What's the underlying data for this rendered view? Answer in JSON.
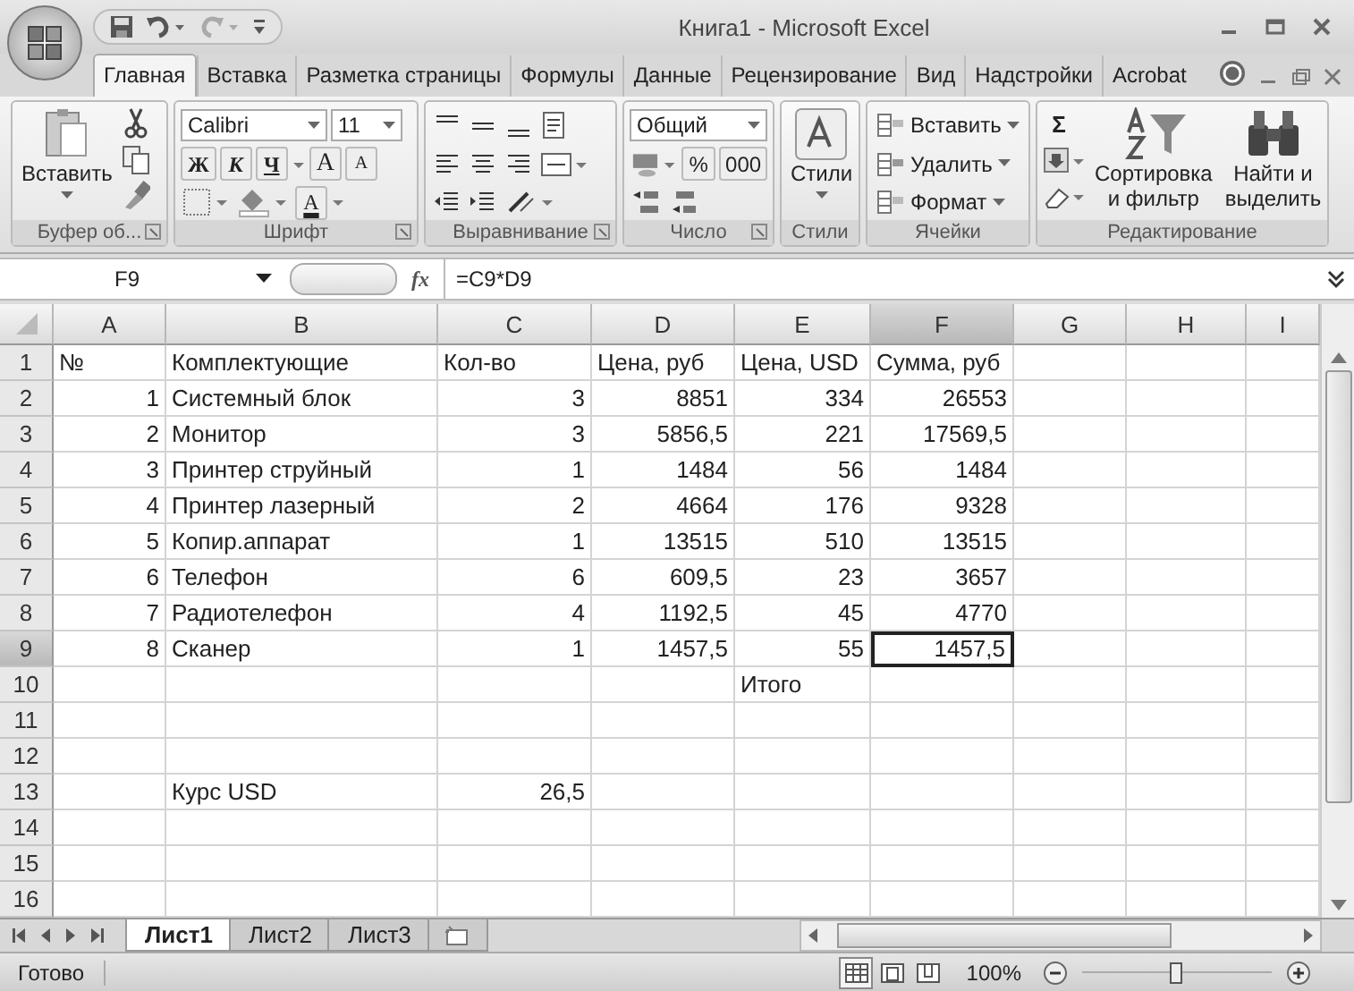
{
  "window": {
    "title": "Книга1 - Microsoft Excel"
  },
  "tabs": [
    {
      "label": "Главная",
      "selected": true
    },
    {
      "label": "Вставка",
      "selected": false
    },
    {
      "label": "Разметка страницы",
      "selected": false
    },
    {
      "label": "Формулы",
      "selected": false
    },
    {
      "label": "Данные",
      "selected": false
    },
    {
      "label": "Рецензирование",
      "selected": false
    },
    {
      "label": "Вид",
      "selected": false
    },
    {
      "label": "Надстройки",
      "selected": false
    },
    {
      "label": "Acrobat",
      "selected": false
    }
  ],
  "ribbon": {
    "clipboard": {
      "label": "Буфер об...",
      "paste": "Вставить"
    },
    "font": {
      "label": "Шрифт",
      "font": "Calibri",
      "size": "11",
      "bold": "Ж",
      "italic": "К",
      "underline": "Ч",
      "grow": "A",
      "shrink": "A",
      "color_letter": "A"
    },
    "alignment": {
      "label": "Выравнивание"
    },
    "number": {
      "label": "Число",
      "format": "Общий",
      "percent": "%",
      "thousands": "000"
    },
    "styles": {
      "label": "Стили",
      "button": "Стили"
    },
    "cells": {
      "label": "Ячейки",
      "buttons": [
        "Вставить",
        "Удалить",
        "Формат"
      ]
    },
    "editing": {
      "label": "Редактирование",
      "sigma": "Σ",
      "sort": [
        "Сортировка",
        "и фильтр"
      ],
      "find": [
        "Найти и",
        "выделить"
      ]
    }
  },
  "formula_bar": {
    "name_box": "F9",
    "fx": "fx",
    "formula": "=C9*D9"
  },
  "columns": [
    {
      "label": "A",
      "selected": false
    },
    {
      "label": "B",
      "selected": false
    },
    {
      "label": "C",
      "selected": false
    },
    {
      "label": "D",
      "selected": false
    },
    {
      "label": "E",
      "selected": false
    },
    {
      "label": "F",
      "selected": true
    },
    {
      "label": "G",
      "selected": false
    },
    {
      "label": "H",
      "selected": false
    },
    {
      "label": "I",
      "selected": false
    }
  ],
  "rows": [
    {
      "number": "1",
      "selected": false,
      "cells": [
        {
          "text": "№",
          "kind": "text"
        },
        {
          "text": "Комплектующие",
          "kind": "text"
        },
        {
          "text": "Кол-во",
          "kind": "text"
        },
        {
          "text": "Цена, руб",
          "kind": "text"
        },
        {
          "text": "Цена, USD",
          "kind": "text"
        },
        {
          "text": "Сумма, руб",
          "kind": "text"
        },
        {},
        {},
        {}
      ]
    },
    {
      "number": "2",
      "selected": false,
      "cells": [
        {
          "text": "1",
          "kind": "number"
        },
        {
          "text": "Системный блок",
          "kind": "text"
        },
        {
          "text": "3",
          "kind": "number"
        },
        {
          "text": "8851",
          "kind": "number"
        },
        {
          "text": "334",
          "kind": "number"
        },
        {
          "text": "26553",
          "kind": "number"
        },
        {},
        {},
        {}
      ]
    },
    {
      "number": "3",
      "selected": false,
      "cells": [
        {
          "text": "2",
          "kind": "number"
        },
        {
          "text": "Монитор",
          "kind": "text"
        },
        {
          "text": "3",
          "kind": "number"
        },
        {
          "text": "5856,5",
          "kind": "number"
        },
        {
          "text": "221",
          "kind": "number"
        },
        {
          "text": "17569,5",
          "kind": "number"
        },
        {},
        {},
        {}
      ]
    },
    {
      "number": "4",
      "selected": false,
      "cells": [
        {
          "text": "3",
          "kind": "number"
        },
        {
          "text": "Принтер струйный",
          "kind": "text"
        },
        {
          "text": "1",
          "kind": "number"
        },
        {
          "text": "1484",
          "kind": "number"
        },
        {
          "text": "56",
          "kind": "number"
        },
        {
          "text": "1484",
          "kind": "number"
        },
        {},
        {},
        {}
      ]
    },
    {
      "number": "5",
      "selected": false,
      "cells": [
        {
          "text": "4",
          "kind": "number"
        },
        {
          "text": "Принтер лазерный",
          "kind": "text"
        },
        {
          "text": "2",
          "kind": "number"
        },
        {
          "text": "4664",
          "kind": "number"
        },
        {
          "text": "176",
          "kind": "number"
        },
        {
          "text": "9328",
          "kind": "number"
        },
        {},
        {},
        {}
      ]
    },
    {
      "number": "6",
      "selected": false,
      "cells": [
        {
          "text": "5",
          "kind": "number"
        },
        {
          "text": "Копир.аппарат",
          "kind": "text"
        },
        {
          "text": "1",
          "kind": "number"
        },
        {
          "text": "13515",
          "kind": "number"
        },
        {
          "text": "510",
          "kind": "number"
        },
        {
          "text": "13515",
          "kind": "number"
        },
        {},
        {},
        {}
      ]
    },
    {
      "number": "7",
      "selected": false,
      "cells": [
        {
          "text": "6",
          "kind": "number"
        },
        {
          "text": "Телефон",
          "kind": "text"
        },
        {
          "text": "6",
          "kind": "number"
        },
        {
          "text": "609,5",
          "kind": "number"
        },
        {
          "text": "23",
          "kind": "number"
        },
        {
          "text": "3657",
          "kind": "number"
        },
        {},
        {},
        {}
      ]
    },
    {
      "number": "8",
      "selected": false,
      "cells": [
        {
          "text": "7",
          "kind": "number"
        },
        {
          "text": "Радиотелефон",
          "kind": "text"
        },
        {
          "text": "4",
          "kind": "number"
        },
        {
          "text": "1192,5",
          "kind": "number"
        },
        {
          "text": "45",
          "kind": "number"
        },
        {
          "text": "4770",
          "kind": "number"
        },
        {},
        {},
        {}
      ]
    },
    {
      "number": "9",
      "selected": true,
      "cells": [
        {
          "text": "8",
          "kind": "number"
        },
        {
          "text": "Сканер",
          "kind": "text"
        },
        {
          "text": "1",
          "kind": "number"
        },
        {
          "text": "1457,5",
          "kind": "number"
        },
        {
          "text": "55",
          "kind": "number"
        },
        {
          "text": "1457,5",
          "kind": "number"
        },
        {},
        {},
        {}
      ]
    },
    {
      "number": "10",
      "selected": false,
      "cells": [
        {},
        {},
        {},
        {},
        {
          "text": "Итого",
          "kind": "text"
        },
        {},
        {},
        {},
        {}
      ]
    },
    {
      "number": "11",
      "selected": false,
      "cells": [
        {},
        {},
        {},
        {},
        {},
        {},
        {},
        {},
        {}
      ]
    },
    {
      "number": "12",
      "selected": false,
      "cells": [
        {},
        {},
        {},
        {},
        {},
        {},
        {},
        {},
        {}
      ]
    },
    {
      "number": "13",
      "selected": false,
      "cells": [
        {},
        {
          "text": "Курс USD",
          "kind": "text"
        },
        {
          "text": "26,5",
          "kind": "number"
        },
        {},
        {},
        {},
        {},
        {},
        {}
      ]
    },
    {
      "number": "14",
      "selected": false,
      "cells": [
        {},
        {},
        {},
        {},
        {},
        {},
        {},
        {},
        {}
      ]
    },
    {
      "number": "15",
      "selected": false,
      "cells": [
        {},
        {},
        {},
        {},
        {},
        {},
        {},
        {},
        {}
      ]
    },
    {
      "number": "16",
      "selected": false,
      "cells": [
        {},
        {},
        {},
        {},
        {},
        {},
        {},
        {},
        {}
      ]
    }
  ],
  "sheet_tabs": [
    {
      "label": "Лист1",
      "selected": true
    },
    {
      "label": "Лист2",
      "selected": false
    },
    {
      "label": "Лист3",
      "selected": false
    }
  ],
  "status_bar": {
    "text": "Готово",
    "views": [
      {
        "kind": "normal",
        "selected": true
      },
      {
        "kind": "layout",
        "selected": false
      },
      {
        "kind": "pagebreak",
        "selected": false
      }
    ],
    "zoom": "100%",
    "zoom_slider": {
      "level": 0.5
    }
  }
}
